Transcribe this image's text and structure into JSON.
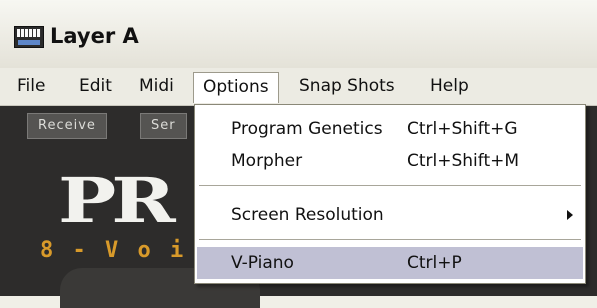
{
  "window": {
    "title": "Layer A",
    "app_icon": "keyboard-synth-icon"
  },
  "menubar": {
    "items": [
      {
        "label": "File"
      },
      {
        "label": "Edit"
      },
      {
        "label": "Midi"
      },
      {
        "label": "Options"
      },
      {
        "label": "Snap Shots"
      },
      {
        "label": "Help"
      }
    ],
    "active": "Options"
  },
  "content": {
    "tabs": [
      {
        "label": "Receive"
      },
      {
        "label": "Ser"
      }
    ],
    "logo_text": "PR",
    "subtitle": "8 - V o i c"
  },
  "options_menu": {
    "items": [
      {
        "label": "Program Genetics",
        "shortcut": "Ctrl+Shift+G"
      },
      {
        "label": "Morpher",
        "shortcut": "Ctrl+Shift+M"
      },
      {
        "label": "Screen Resolution",
        "shortcut": "",
        "submenu_icon": "submenu-arrow-icon"
      },
      {
        "label": "V-Piano",
        "shortcut": "Ctrl+P",
        "highlighted": true
      }
    ]
  },
  "colors": {
    "highlight": "#c0c0d4",
    "content_bg": "#2d2c2b",
    "subtitle": "#d89a2a"
  }
}
